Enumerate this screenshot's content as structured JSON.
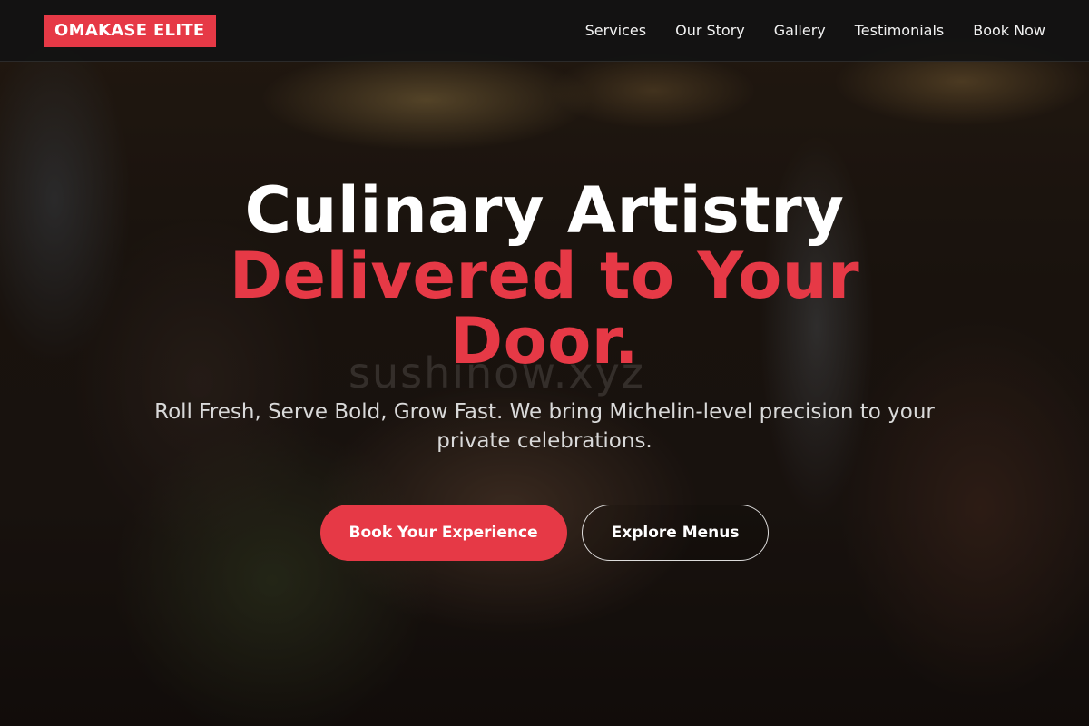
{
  "header": {
    "brand": "OMAKASE ELITE",
    "nav": [
      {
        "label": "Services"
      },
      {
        "label": "Our Story"
      },
      {
        "label": "Gallery"
      },
      {
        "label": "Testimonials"
      },
      {
        "label": "Book Now"
      }
    ]
  },
  "hero": {
    "headline_line1": "Culinary Artistry",
    "headline_accent": "Delivered to Your Door.",
    "subheadline": "Roll Fresh, Serve Bold, Grow Fast. We bring Michelin-level precision to your private celebrations.",
    "primary_cta": "Book Your Experience",
    "secondary_cta": "Explore Menus",
    "watermark": "sushinow.xyz"
  },
  "colors": {
    "accent": "#e63946",
    "navbar_bg": "#121212",
    "text_primary": "#ffffff",
    "text_secondary": "#d9d9d9"
  }
}
